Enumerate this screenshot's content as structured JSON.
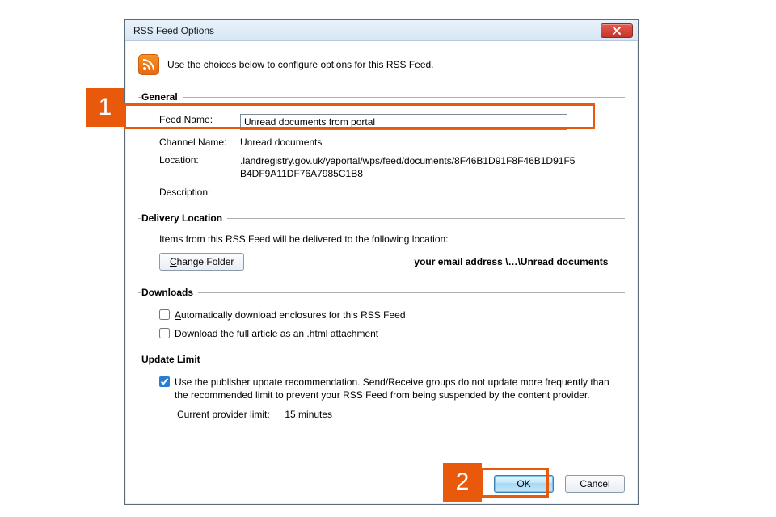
{
  "window": {
    "title": "RSS Feed Options"
  },
  "intro": {
    "text": "Use the choices below to configure options for this RSS Feed."
  },
  "callouts": {
    "one": "1",
    "two": "2"
  },
  "general": {
    "legend": "General",
    "feed_name_label": "Feed Name:",
    "feed_name_value": "Unread documents from portal",
    "channel_name_label": "Channel Name:",
    "channel_name_value": "Unread documents",
    "location_label": "Location:",
    "location_value": ".landregistry.gov.uk/yaportal/wps/feed/documents/8F46B1D91F8F46B1D91F5B4DF9A11DF76A7985C1B8",
    "description_label": "Description:"
  },
  "delivery": {
    "legend": "Delivery Location",
    "help": "Items from this RSS Feed will be delivered to the following location:",
    "change_folder": "Change Folder",
    "path": "your email address \\…\\Unread documents"
  },
  "downloads": {
    "legend": "Downloads",
    "enclosures": "Automatically download enclosures for this RSS Feed",
    "fullhtml": "Download the full article as an .html attachment"
  },
  "update": {
    "legend": "Update Limit",
    "recommend": "Use the publisher update recommendation. Send/Receive groups do not update more frequently than the recommended limit to prevent your RSS Feed from being suspended by the content provider.",
    "limit_label": "Current provider limit:",
    "limit_value": "15 minutes"
  },
  "buttons": {
    "ok": "OK",
    "cancel": "Cancel"
  }
}
